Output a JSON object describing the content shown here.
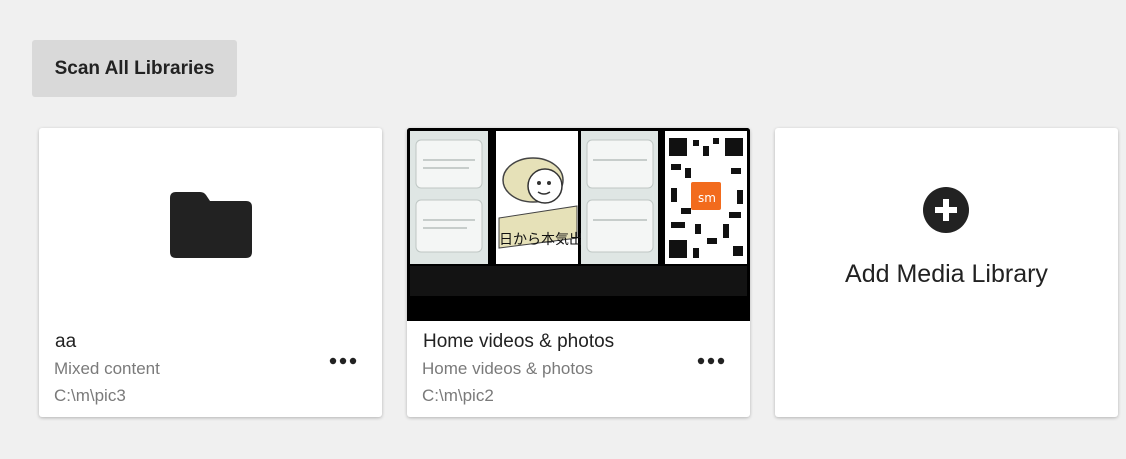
{
  "toolbar": {
    "scan_label": "Scan All Libraries"
  },
  "libraries": [
    {
      "title": "aa",
      "subtitle": "Mixed content",
      "path": "C:\\m\\pic3",
      "icon": "folder-icon"
    },
    {
      "title": "Home videos & photos",
      "subtitle": "Home videos & photos",
      "path": "C:\\m\\pic2",
      "thumbnail_text": [
        "日から本気出",
        "sm"
      ]
    }
  ],
  "add_card": {
    "label": "Add Media Library",
    "icon": "plus-circle-icon"
  },
  "colors": {
    "background": "#f0f0f0",
    "card": "#ffffff",
    "button": "#d9d9d9",
    "muted_text": "#7a7a7a",
    "icon": "#222222",
    "accent_badge": "#f26b1d"
  }
}
